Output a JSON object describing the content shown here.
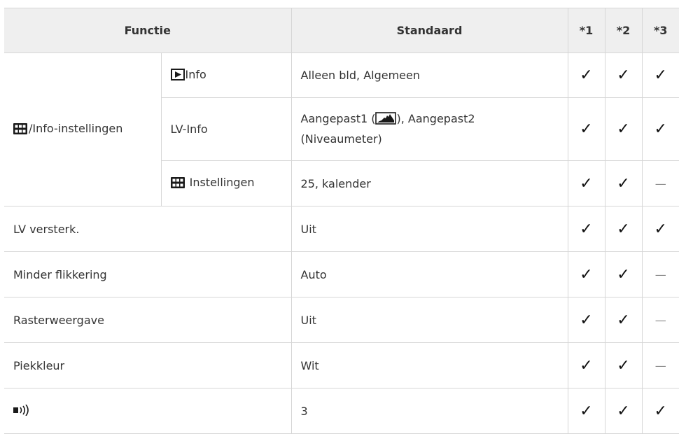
{
  "header": {
    "function": "Functie",
    "standard": "Standaard",
    "c1": "*1",
    "c2": "*2",
    "c3": "*3"
  },
  "group": {
    "label": "/Info-instellingen"
  },
  "rows": {
    "info": {
      "sub": "Info",
      "standard": "Alleen bld, Algemeen",
      "marks": [
        "check",
        "check",
        "check"
      ]
    },
    "lvinfo": {
      "sub": "LV-Info",
      "standard_a": "Aangepast1 (",
      "standard_b": "), Aangepast2 (Niveaumeter)",
      "marks": [
        "check",
        "check",
        "check"
      ]
    },
    "settings": {
      "sub": "Instellingen",
      "standard": "25, kalender",
      "marks": [
        "check",
        "check",
        "dash"
      ]
    },
    "lv_boost": {
      "label": "LV versterk.",
      "standard": "Uit",
      "marks": [
        "check",
        "check",
        "check"
      ]
    },
    "flicker": {
      "label": "Minder flikkering",
      "standard": "Auto",
      "marks": [
        "check",
        "check",
        "dash"
      ]
    },
    "grid": {
      "label": "Rasterweergave",
      "standard": "Uit",
      "marks": [
        "check",
        "check",
        "dash"
      ]
    },
    "peak": {
      "label": "Piekkleur",
      "standard": "Wit",
      "marks": [
        "check",
        "check",
        "dash"
      ]
    },
    "beep": {
      "label": "",
      "standard": "3",
      "marks": [
        "check",
        "check",
        "check"
      ]
    }
  },
  "symbols": {
    "check": "✓",
    "dash": "—"
  },
  "icons": [
    "grid-icon",
    "play-icon",
    "histogram-icon",
    "sound-icon"
  ]
}
